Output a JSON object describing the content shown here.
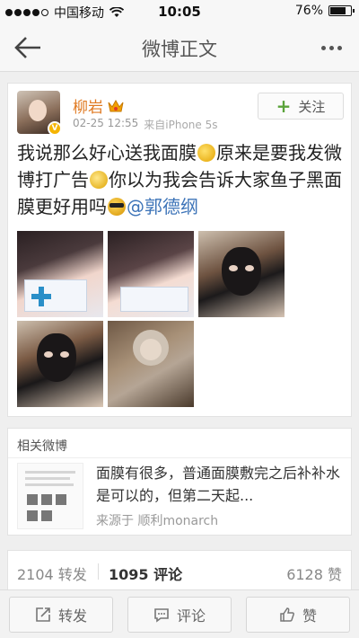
{
  "status_bar": {
    "carrier": "中国移动",
    "time": "10:05",
    "battery": "76%",
    "battery_level": 0.76
  },
  "nav": {
    "title": "微博正文",
    "back_icon": "arrow-left-icon",
    "more_icon": "more-dots-icon"
  },
  "post": {
    "author": "柳岩",
    "verified_badge": "V",
    "date": "02-25 12:55",
    "source": "来自iPhone 5s",
    "follow_label": "关注",
    "text_1": "我说那么好心送我面膜",
    "text_2": "原来是要我发微博打广告",
    "text_3": "你以为我会告诉大家鱼子黑面膜更好用吗",
    "mention": "@郭德纲",
    "photo_count": 5
  },
  "related": {
    "header": "相关微博",
    "text": "面膜有很多，普通面膜敷完之后补补水是可以的，但第二天起...",
    "source": "来源于 顺利monarch"
  },
  "stats": {
    "reposts": "2104 转发",
    "comments": "1095 评论",
    "likes": "6128 赞"
  },
  "toolbar": {
    "repost": "转发",
    "comment": "评论",
    "like": "赞"
  },
  "colors": {
    "username": "#e07a22",
    "mention": "#3d74b8",
    "follow_plus": "#5aa33a",
    "badge": "#f5b400"
  }
}
